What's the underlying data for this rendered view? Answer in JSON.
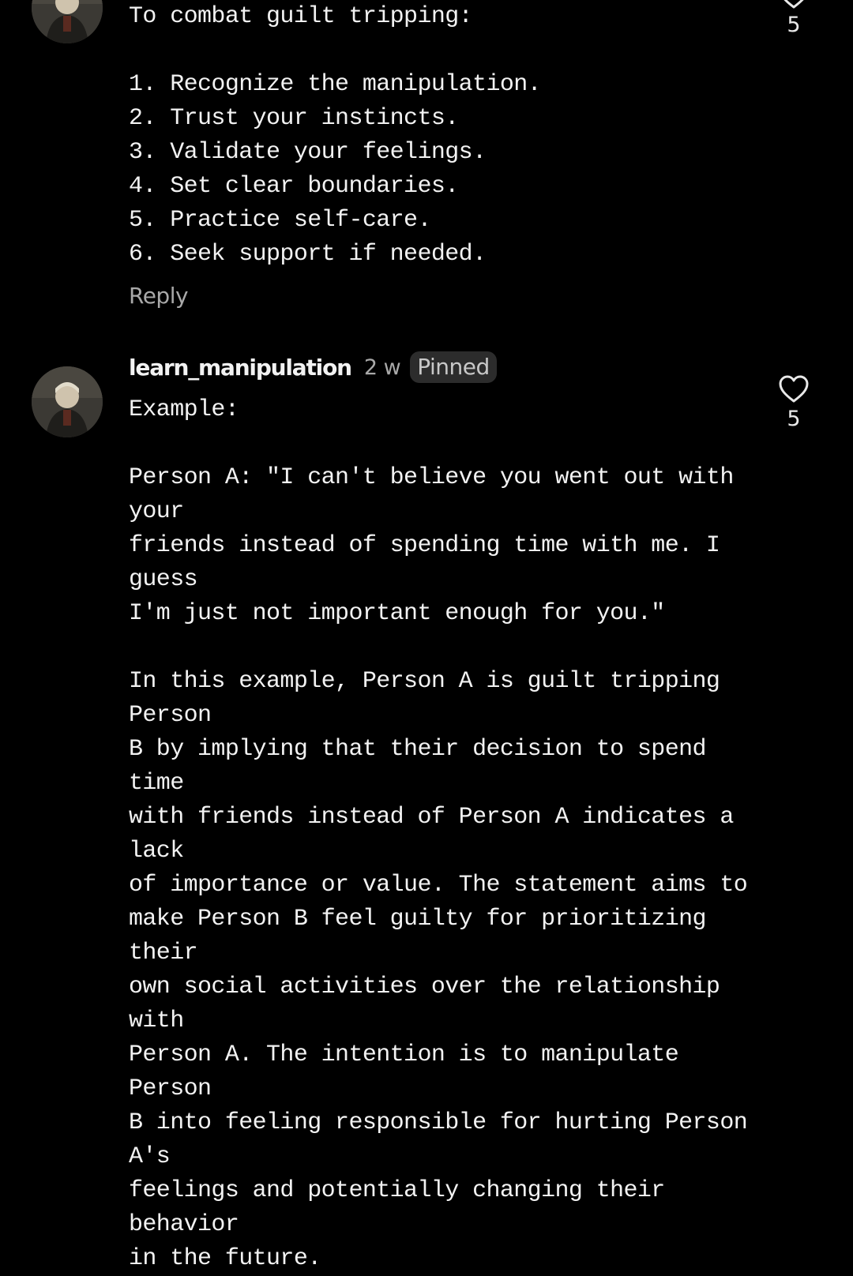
{
  "comments": [
    {
      "body": "To combat guilt tripping:\n\n1. Recognize the manipulation.\n2. Trust your instincts.\n3. Validate your feelings.\n4. Set clear boundaries.\n5. Practice self-care.\n6. Seek support if needed.",
      "reply_label": "Reply",
      "like_count": "5",
      "like_icon": "heart-outline-icon"
    },
    {
      "username": "learn_manipulation",
      "time": "2 w",
      "badge": "Pinned",
      "body": "Example:\n\nPerson A: \"I can't believe you went out with your\nfriends instead of spending time with me. I guess\nI'm just not important enough for you.\"\n\nIn this example, Person A is guilt tripping Person\nB by implying that their decision to spend time\nwith friends instead of Person A indicates a lack\nof importance or value. The statement aims to\nmake Person B feel guilty for prioritizing their\nown social activities over the relationship with\nPerson A. The intention is to manipulate Person\nB into feeling responsible for hurting Person A's\nfeelings and potentially changing their behavior\nin the future.",
      "like_count": "5",
      "like_icon": "heart-outline-icon"
    }
  ],
  "colors": {
    "background": "#000000",
    "text": "#f2f2f2",
    "muted": "#a9a9a9",
    "badge_bg": "#2c2c2c"
  }
}
